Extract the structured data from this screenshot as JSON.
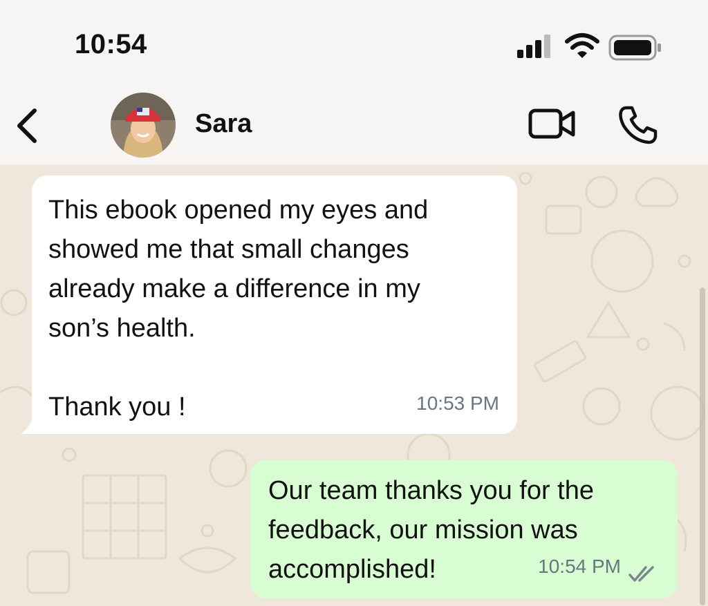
{
  "status_bar": {
    "time": "10:54",
    "icons": [
      "cellular-signal-icon",
      "wifi-icon",
      "battery-icon"
    ]
  },
  "header": {
    "contact_name": "Sara",
    "icons": [
      "back-chevron-icon",
      "avatar",
      "video-call-icon",
      "voice-call-icon"
    ]
  },
  "messages": [
    {
      "direction": "incoming",
      "text": "This ebook opened my eyes and\nshowed me that small changes\nalready make a difference in my\nson’s health.\n\nThank you !",
      "time": "10:53 PM"
    },
    {
      "direction": "outgoing",
      "text": "Our team thanks you for the\nfeedback, our mission was\naccomplished!",
      "time": "10:54 PM",
      "status_icon": "double-check-icon"
    }
  ],
  "colors": {
    "header_bg": "#f6f5f3",
    "chat_bg": "#efe7dc",
    "incoming_bubble": "#ffffff",
    "outgoing_bubble": "#d9fdd3",
    "timestamp": "#667781"
  }
}
